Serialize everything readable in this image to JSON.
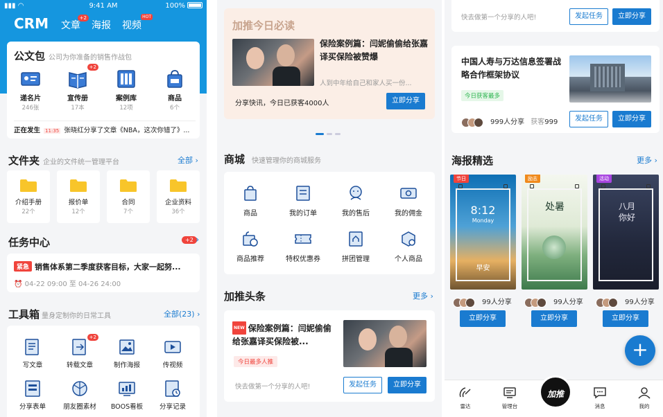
{
  "colors": {
    "primary": "#1596df",
    "accent": "#1a7bd0",
    "badge": "#f0443c",
    "hero_bg": "#fbeee6"
  },
  "status": {
    "time": "9:41 AM",
    "battery": "100%"
  },
  "nav": {
    "brand": "CRM",
    "tabs": [
      {
        "label": "文章",
        "badge": "+2"
      },
      {
        "label": "海报"
      },
      {
        "label": "视频",
        "badge": "HOT"
      }
    ]
  },
  "gongwenbao": {
    "title": "公文包",
    "subtitle": "公司为你准备的销售作战包",
    "items": [
      {
        "label": "递名片",
        "count": "246张",
        "icon": "business-card-icon"
      },
      {
        "label": "宣传册",
        "count": "17本",
        "icon": "brochure-icon",
        "badge": "+2"
      },
      {
        "label": "案例库",
        "count": "12项",
        "icon": "case-library-icon"
      },
      {
        "label": "商品",
        "count": "6个",
        "icon": "product-bag-icon"
      }
    ],
    "happening_label": "正在发生",
    "happening_time": "11:35",
    "happening_text": "张晓红分享了文章《NBA，这次你错了》..."
  },
  "files": {
    "title": "文件夹",
    "subtitle": "企业的文件统一管理平台",
    "more": "全部",
    "items": [
      {
        "label": "介绍手册",
        "count": "22个"
      },
      {
        "label": "报价单",
        "count": "12个"
      },
      {
        "label": "合同",
        "count": "7个"
      },
      {
        "label": "企业资料",
        "count": "36个"
      }
    ]
  },
  "tasks": {
    "title": "任务中心",
    "badge": "+2",
    "tag": "紧急",
    "text": "销售体系第二季度获客目标，大家一起努...",
    "time": "04-22 09:00 至 04-26 24:00"
  },
  "toolbox": {
    "title": "工具箱",
    "subtitle": "量身定制你的日常工具",
    "more": "全部(23)",
    "items": [
      {
        "label": "写文章",
        "icon": "write-article-icon"
      },
      {
        "label": "转载文章",
        "icon": "repost-article-icon",
        "badge": "+2"
      },
      {
        "label": "制作海报",
        "icon": "make-poster-icon"
      },
      {
        "label": "传视频",
        "icon": "upload-video-icon"
      },
      {
        "label": "分享表单",
        "icon": "share-form-icon"
      },
      {
        "label": "朋友圈素材",
        "icon": "moments-material-icon"
      },
      {
        "label": "BOOS看板",
        "icon": "dashboard-icon"
      },
      {
        "label": "分享记录",
        "icon": "share-record-icon"
      }
    ]
  },
  "hero": {
    "label": "加推今日必读",
    "title": "保险案例篇：闫妮偷偷给张嘉译买保险被赞爆",
    "snippet": "人到中年给自己和家人买一份...",
    "quick": "分享快讯，今日已获客4000人",
    "share_btn": "立即分享"
  },
  "mall": {
    "title": "商城",
    "subtitle": "快速管理你的商城服务",
    "items": [
      {
        "label": "商品",
        "icon": "goods-icon"
      },
      {
        "label": "我的订单",
        "icon": "orders-icon"
      },
      {
        "label": "我的售后",
        "icon": "after-sales-icon"
      },
      {
        "label": "我的佣金",
        "icon": "commission-icon"
      },
      {
        "label": "商品推荐",
        "icon": "recommend-icon"
      },
      {
        "label": "特权优惠券",
        "icon": "coupon-icon"
      },
      {
        "label": "拼团管理",
        "icon": "group-buy-icon"
      },
      {
        "label": "个人商品",
        "icon": "personal-goods-icon"
      }
    ]
  },
  "headline": {
    "title": "加推头条",
    "more": "更多",
    "new_tag": "NEW",
    "article": "保险案例篇：闫妮偷偷给张嘉译买保险被...",
    "tag": "今日最多人推",
    "tip": "快去做第一个分享的人吧!",
    "task_btn": "发起任务",
    "share_btn": "立即分享"
  },
  "p3": {
    "top_tip": "快去做第一个分享的人吧!",
    "task_btn": "发起任务",
    "share_btn": "立即分享",
    "article_title": "中国人寿与万达信息签署战略合作框架协议",
    "article_tag": "今日获客最多",
    "share_count": "999",
    "share_unit": "人分享",
    "gain_label": "获客",
    "gain_count": "999"
  },
  "posters": {
    "title": "海报精选",
    "more": "更多",
    "items": [
      {
        "tag": "节日",
        "tag_color": "#f0443c",
        "caption": "早安",
        "time": "8:12",
        "sub": "Monday",
        "count": "99",
        "unit": "人分享",
        "btn": "立即分享"
      },
      {
        "tag": "励志",
        "tag_color": "#f08a1c",
        "caption": "处暑",
        "count": "99",
        "unit": "人分享",
        "btn": "立即分享"
      },
      {
        "tag": "活动",
        "tag_color": "#a845e0",
        "caption": "八月你好",
        "count": "99",
        "unit": "人分享",
        "btn": "立即分享"
      }
    ]
  },
  "tabbar": {
    "items": [
      {
        "label": "雷达",
        "icon": "radar-icon"
      },
      {
        "label": "管理台",
        "icon": "console-icon"
      },
      {
        "label": "消息",
        "icon": "message-icon"
      },
      {
        "label": "我的",
        "icon": "profile-icon"
      }
    ],
    "center": "加推",
    "fab": "+"
  }
}
